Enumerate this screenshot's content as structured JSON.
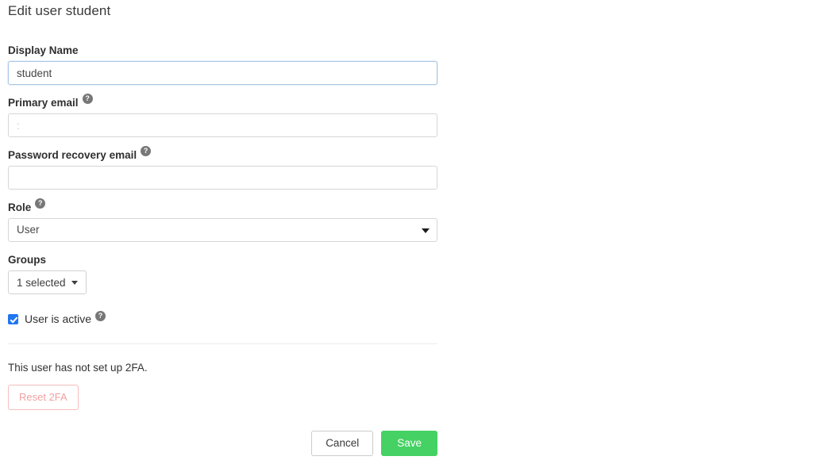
{
  "page": {
    "title": "Edit user student"
  },
  "form": {
    "display_name": {
      "label": "Display Name",
      "value": "student",
      "placeholder": ""
    },
    "primary_email": {
      "label": "Primary email",
      "help_icon": "help-circle-icon",
      "help_glyph": "?",
      "value": ":",
      "placeholder": ""
    },
    "password_recovery_email": {
      "label": "Password recovery email",
      "help_icon": "help-circle-icon",
      "help_glyph": "?",
      "value": "",
      "placeholder": ""
    },
    "role": {
      "label": "Role",
      "help_icon": "help-circle-icon",
      "help_glyph": "?",
      "selected": "User",
      "options": [
        "User"
      ],
      "caret_icon": "chevron-down-icon"
    },
    "groups": {
      "label": "Groups",
      "button_label": "1 selected",
      "caret_icon": "chevron-down-icon"
    },
    "user_is_active": {
      "label": "User is active",
      "checked": true,
      "help_icon": "help-circle-icon",
      "help_glyph": "?"
    }
  },
  "twofa": {
    "status_text": "This user has not set up 2FA.",
    "reset_label": "Reset 2FA"
  },
  "actions": {
    "cancel_label": "Cancel",
    "save_label": "Save"
  },
  "colors": {
    "save_green": "#45d163",
    "reset_pink_border": "#f7bdbd",
    "reset_pink_text": "#f2a0a0",
    "checkbox_blue": "#2176f0",
    "focus_border_blue": "#a9c7e4",
    "input_border": "#d6d6d6",
    "help_badge_gray": "#777777"
  }
}
